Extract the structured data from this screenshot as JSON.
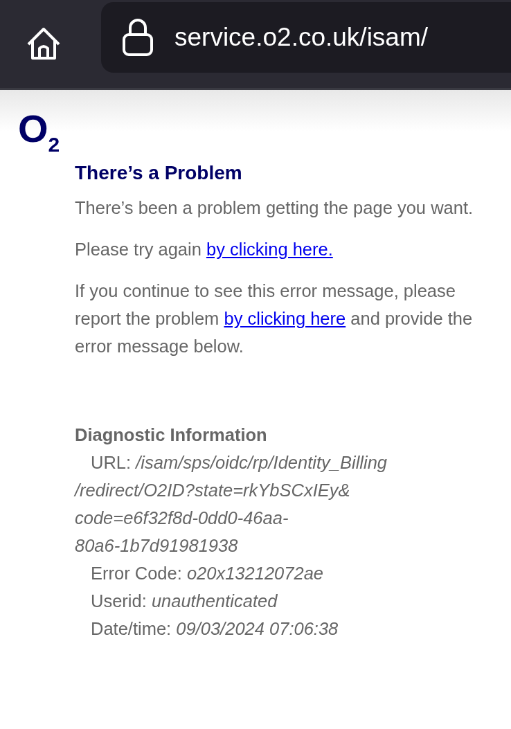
{
  "browser": {
    "url": "service.o2.co.uk/isam/"
  },
  "logo": {
    "letter": "O",
    "subscript": "2"
  },
  "heading": "There’s a Problem",
  "paragraphs": [
    {
      "text": "There’s been a problem getting the page you want."
    },
    {
      "text": "Please try again",
      "link": "by clicking here."
    },
    {
      "text": "If you continue to see this error message, please report the problem",
      "link": "by clicking here",
      "after": "and provide the error message below."
    }
  ],
  "diagnostic": {
    "title": "Diagnostic Information",
    "rows": [
      {
        "label": "URL:",
        "value_lines": [
          "/isam/sps/oidc/rp/Identity_Billing",
          "/redirect/O2ID?state=rkYbSCxIEy&",
          "code=e6f32f8d-0dd0-46aa-",
          "80a6-1b7d91981938"
        ]
      },
      {
        "label": "Error Code:",
        "value_lines": [
          "o20x13212072ae"
        ]
      },
      {
        "label": "Userid:",
        "value_lines": [
          "unauthenticated"
        ]
      },
      {
        "label": "Date/time:",
        "value_lines": [
          "09/03/2024 07:06:38"
        ]
      }
    ]
  }
}
